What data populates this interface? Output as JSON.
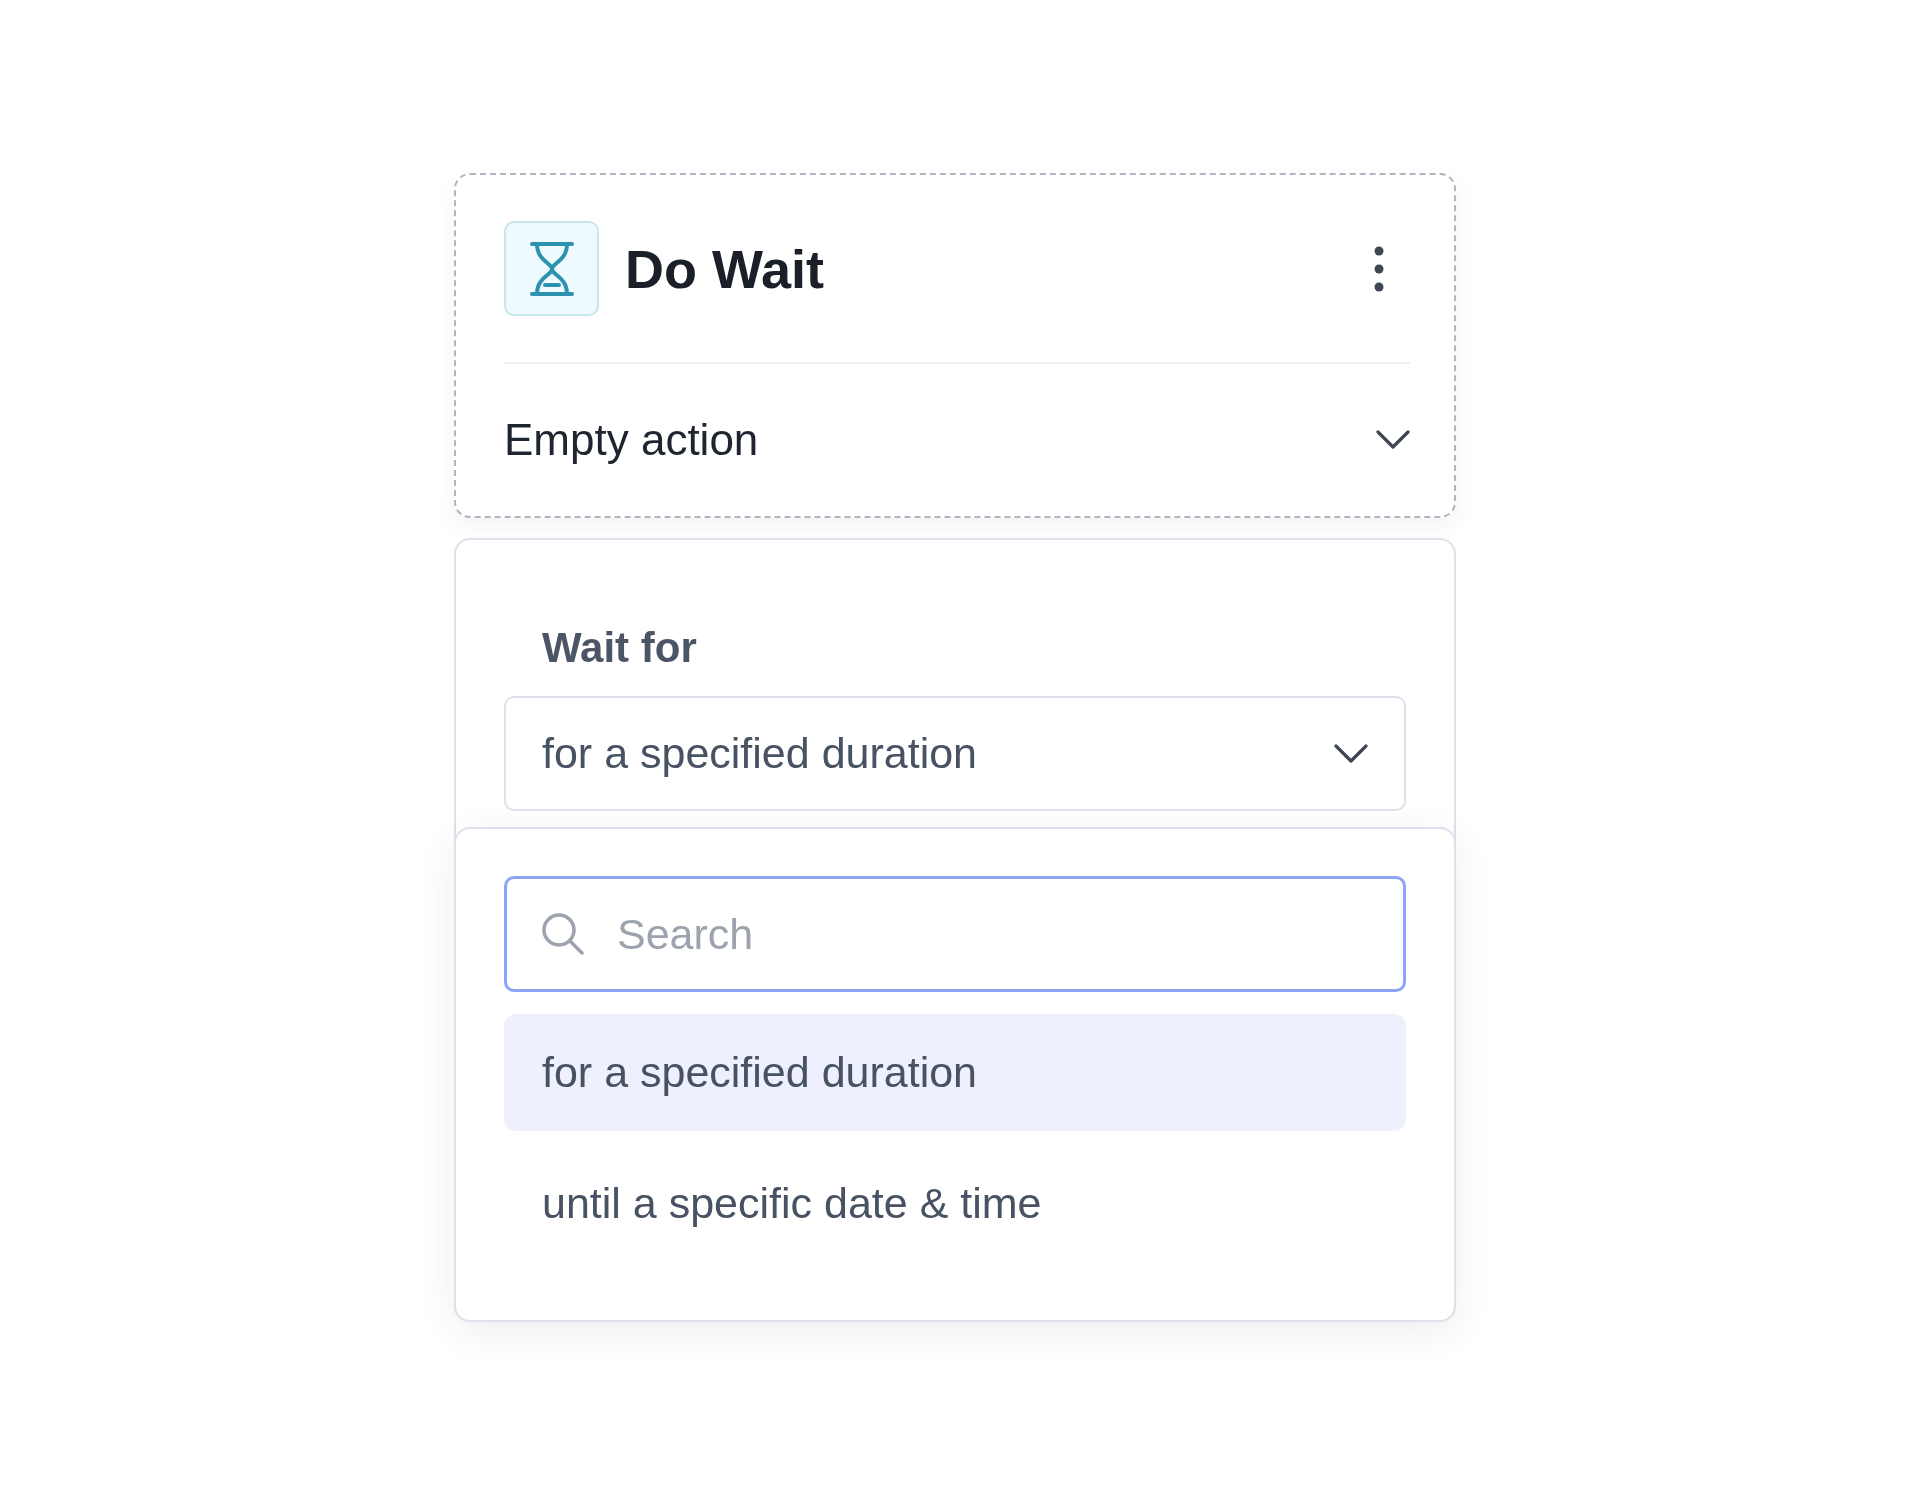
{
  "node": {
    "title": "Do Wait",
    "action": "Empty action"
  },
  "settings": {
    "label": "Wait for",
    "select": {
      "value": "for a specified duration",
      "expanded": true
    }
  },
  "dropdown": {
    "search": {
      "placeholder": "Search"
    },
    "options": [
      {
        "label": "for a specified duration",
        "selected": true
      },
      {
        "label": "until a specific date & time",
        "selected": false
      }
    ]
  }
}
